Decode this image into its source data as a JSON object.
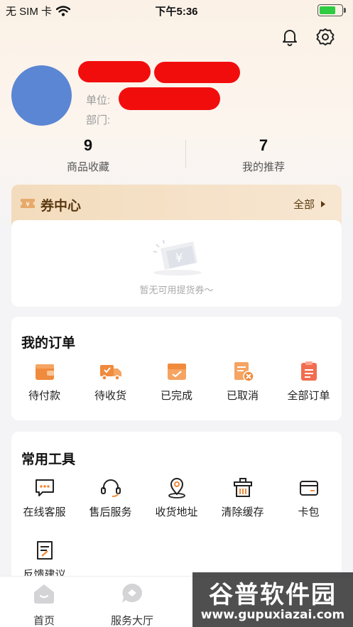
{
  "status_bar": {
    "carrier": "无 SIM 卡",
    "time": "下午5:36",
    "battery_level": 0.72
  },
  "header": {
    "icons": [
      "bell-icon",
      "gear-icon"
    ]
  },
  "profile": {
    "unit_label": "单位:",
    "dept_label": "部门:"
  },
  "stats": [
    {
      "value": "9",
      "label": "商品收藏"
    },
    {
      "value": "7",
      "label": "我的推荐"
    }
  ],
  "coupon_center": {
    "title": "券中心",
    "all_label": "全部",
    "empty_text": "暂无可用提货券～"
  },
  "orders": {
    "title": "我的订单",
    "items": [
      {
        "label": "待付款",
        "icon": "wallet-icon"
      },
      {
        "label": "待收货",
        "icon": "truck-icon"
      },
      {
        "label": "已完成",
        "icon": "box-check-icon"
      },
      {
        "label": "已取消",
        "icon": "cancel-doc-icon"
      },
      {
        "label": "全部订单",
        "icon": "clipboard-icon"
      }
    ]
  },
  "tools": {
    "title": "常用工具",
    "items": [
      {
        "label": "在线客服",
        "icon": "chat-icon"
      },
      {
        "label": "售后服务",
        "icon": "headset-icon"
      },
      {
        "label": "收货地址",
        "icon": "location-pin-icon"
      },
      {
        "label": "清除缓存",
        "icon": "trash-icon"
      },
      {
        "label": "卡包",
        "icon": "card-wallet-icon"
      },
      {
        "label": "反馈建议",
        "icon": "feedback-icon"
      }
    ]
  },
  "tabbar": {
    "tabs": [
      {
        "label": "首页"
      },
      {
        "label": "服务大厅"
      }
    ]
  },
  "watermark": {
    "text": "谷普软件园",
    "url": "www.gupuxiazai.com"
  },
  "colors": {
    "accent_orange": "#f08a3c",
    "avatar_blue": "#5b86d4",
    "coupon_brown": "#5b3a12",
    "redaction_red": "#f20d0d"
  }
}
